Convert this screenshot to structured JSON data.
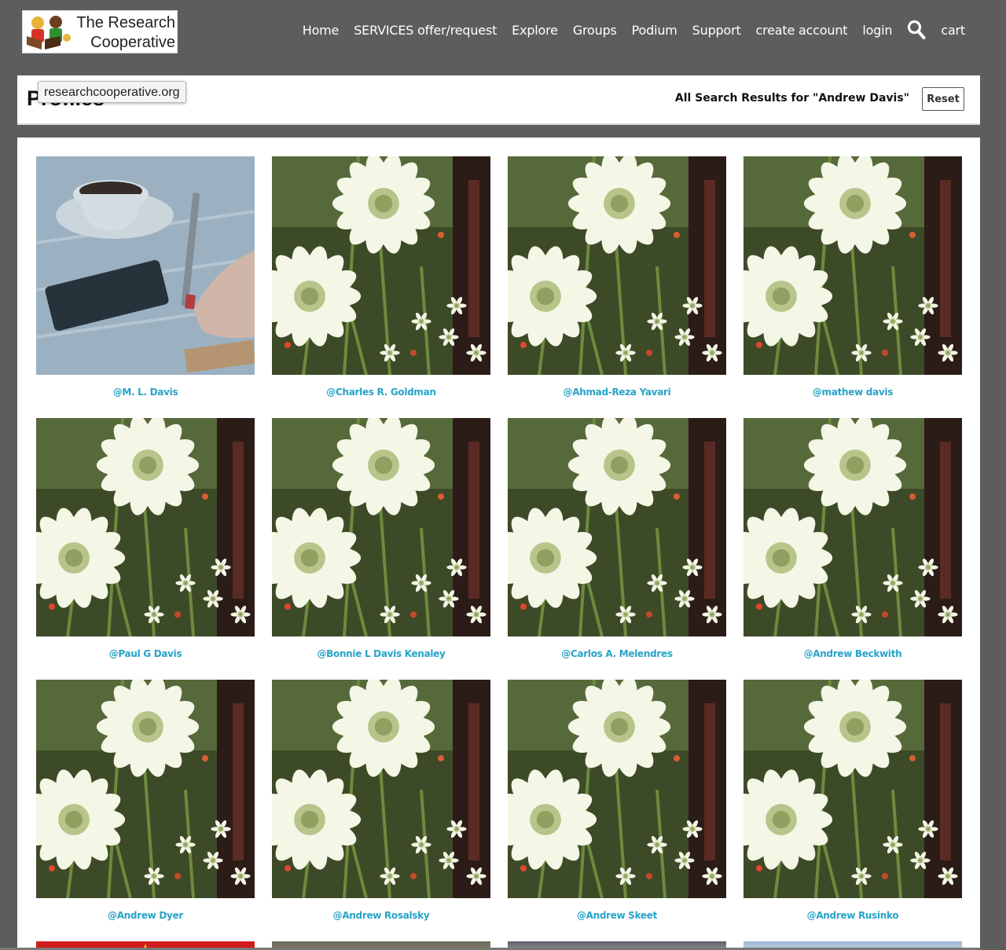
{
  "brand": {
    "name_line1": "The Research",
    "name_line2": "Cooperative"
  },
  "nav": [
    {
      "id": "home",
      "label": "Home"
    },
    {
      "id": "services",
      "label": "SERVICES offer/request"
    },
    {
      "id": "explore",
      "label": "Explore"
    },
    {
      "id": "groups",
      "label": "Groups"
    },
    {
      "id": "podium",
      "label": "Podium"
    },
    {
      "id": "support",
      "label": "Support"
    },
    {
      "id": "create-account",
      "label": "create account"
    },
    {
      "id": "login",
      "label": "login"
    },
    {
      "id": "search",
      "icon": "search-icon"
    },
    {
      "id": "cart",
      "label": "cart"
    }
  ],
  "header": {
    "title": "Profiles",
    "tooltip": "researchcooperative.org",
    "results_label": "All Search Results for \"Andrew Davis\"",
    "reset_label": "Reset"
  },
  "profiles": [
    {
      "handle": "@M. L. Davis",
      "image": "coffee-writing-photo"
    },
    {
      "handle": "@Charles R. Goldman",
      "image": "white-flowers-photo"
    },
    {
      "handle": "@Ahmad-Reza Yavari",
      "image": "white-flowers-photo"
    },
    {
      "handle": "@mathew davis",
      "image": "white-flowers-photo"
    },
    {
      "handle": "@Paul G Davis",
      "image": "white-flowers-photo"
    },
    {
      "handle": "@Bonnie L Davis Kenaley",
      "image": "white-flowers-photo"
    },
    {
      "handle": "@Carlos A. Melendres",
      "image": "white-flowers-photo"
    },
    {
      "handle": "@Andrew Beckwith",
      "image": "white-flowers-photo"
    },
    {
      "handle": "@Andrew Dyer",
      "image": "white-flowers-photo"
    },
    {
      "handle": "@Andrew Rosalsky",
      "image": "white-flowers-photo"
    },
    {
      "handle": "@Andrew Skeet",
      "image": "white-flowers-photo"
    },
    {
      "handle": "@Andrew Rusinko",
      "image": "white-flowers-photo"
    }
  ],
  "colors": {
    "topbar": "#5d5d5d",
    "link": "#27a3c8"
  }
}
